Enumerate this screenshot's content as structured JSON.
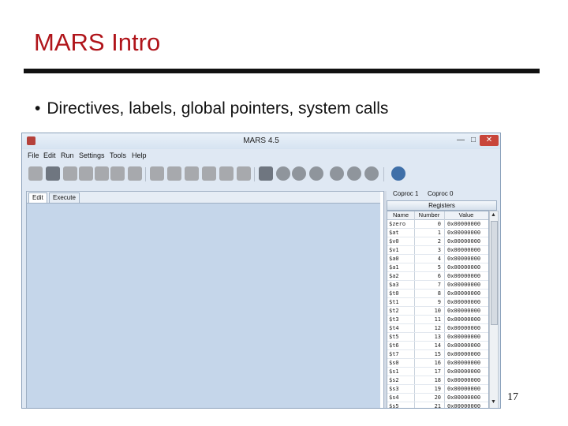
{
  "slide": {
    "title": "MARS Intro",
    "bullet_marker": "•",
    "bullet": "Directives, labels, global pointers, system calls",
    "page_number": "17",
    "title_color": "#b0141a"
  },
  "app": {
    "title": "MARS 4.5",
    "controls": {
      "minimize": "—",
      "maximize": "□",
      "close": "✕"
    },
    "menu": [
      "File",
      "Edit",
      "Run",
      "Settings",
      "Tools",
      "Help"
    ],
    "tabs": [
      "Edit",
      "Execute"
    ],
    "coproc_tabs": [
      "Coproc 1",
      "Coproc 0"
    ],
    "registers": {
      "header": "Registers",
      "columns": [
        "Name",
        "Number",
        "Value"
      ],
      "rows": [
        {
          "name": "$zero",
          "number": "0",
          "value": "0x00000000"
        },
        {
          "name": "$at",
          "number": "1",
          "value": "0x00000000"
        },
        {
          "name": "$v0",
          "number": "2",
          "value": "0x00000000"
        },
        {
          "name": "$v1",
          "number": "3",
          "value": "0x00000000"
        },
        {
          "name": "$a0",
          "number": "4",
          "value": "0x00000000"
        },
        {
          "name": "$a1",
          "number": "5",
          "value": "0x00000000"
        },
        {
          "name": "$a2",
          "number": "6",
          "value": "0x00000000"
        },
        {
          "name": "$a3",
          "number": "7",
          "value": "0x00000000"
        },
        {
          "name": "$t0",
          "number": "8",
          "value": "0x00000000"
        },
        {
          "name": "$t1",
          "number": "9",
          "value": "0x00000000"
        },
        {
          "name": "$t2",
          "number": "10",
          "value": "0x00000000"
        },
        {
          "name": "$t3",
          "number": "11",
          "value": "0x00000000"
        },
        {
          "name": "$t4",
          "number": "12",
          "value": "0x00000000"
        },
        {
          "name": "$t5",
          "number": "13",
          "value": "0x00000000"
        },
        {
          "name": "$t6",
          "number": "14",
          "value": "0x00000000"
        },
        {
          "name": "$t7",
          "number": "15",
          "value": "0x00000000"
        },
        {
          "name": "$s0",
          "number": "16",
          "value": "0x00000000"
        },
        {
          "name": "$s1",
          "number": "17",
          "value": "0x00000000"
        },
        {
          "name": "$s2",
          "number": "18",
          "value": "0x00000000"
        },
        {
          "name": "$s3",
          "number": "19",
          "value": "0x00000000"
        },
        {
          "name": "$s4",
          "number": "20",
          "value": "0x00000000"
        },
        {
          "name": "$s5",
          "number": "21",
          "value": "0x00000000"
        }
      ]
    }
  }
}
